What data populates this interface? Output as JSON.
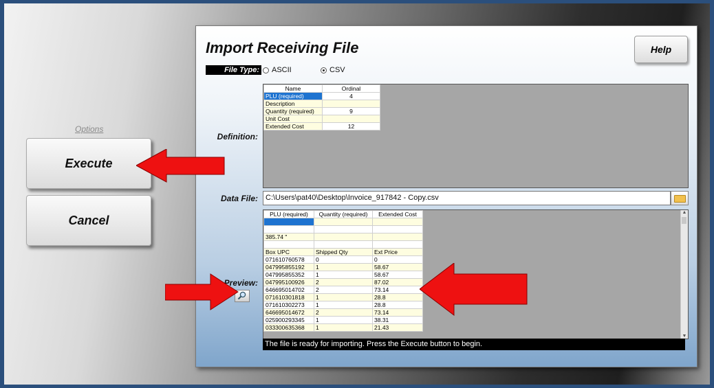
{
  "left": {
    "options_label": "Options",
    "execute_label": "Execute",
    "cancel_label": "Cancel"
  },
  "panel": {
    "title": "Import Receiving File",
    "help_label": "Help",
    "file_type_label": "File Type:",
    "file_types": [
      {
        "label": "ASCII",
        "selected": false
      },
      {
        "label": "CSV",
        "selected": true
      }
    ],
    "definition_label": "Definition:",
    "definition_table": {
      "headers": [
        "Name",
        "Ordinal"
      ],
      "rows": [
        {
          "name": "PLU (required)",
          "ordinal": "4"
        },
        {
          "name": "Description",
          "ordinal": ""
        },
        {
          "name": "Quantity (required)",
          "ordinal": "9"
        },
        {
          "name": "Unit Cost",
          "ordinal": ""
        },
        {
          "name": "Extended Cost",
          "ordinal": "12"
        }
      ]
    },
    "data_file_label": "Data File:",
    "data_file_value": "C:\\Users\\pat40\\Desktop\\Invoice_917842 - Copy.csv",
    "preview_label": "Preview:",
    "preview_table": {
      "headers": [
        "PLU (required)",
        "Quantity (required)",
        "Extended Cost"
      ],
      "rows": [
        [
          "",
          "",
          ""
        ],
        [
          "",
          "",
          ""
        ],
        [
          "385.74 \"",
          "",
          ""
        ],
        [
          "",
          "",
          ""
        ],
        [
          "Box UPC",
          "Shipped Qty",
          "Ext Price"
        ],
        [
          "071610760578",
          "0",
          "0"
        ],
        [
          "047995855192",
          "1",
          "58.67"
        ],
        [
          "047995855352",
          "1",
          "58.67"
        ],
        [
          "047995100926",
          "2",
          "87.02"
        ],
        [
          "646695014702",
          "2",
          "73.14"
        ],
        [
          "071610301818",
          "1",
          "28.8"
        ],
        [
          "071610302273",
          "1",
          "28.8"
        ],
        [
          "646695014672",
          "2",
          "73.14"
        ],
        [
          "025900293345",
          "1",
          "38.31"
        ],
        [
          "033300635368",
          "1",
          "21.43"
        ]
      ]
    },
    "status_text": "The file is ready for importing. Press the Execute button to begin."
  },
  "colors": {
    "arrow": "#ee1111",
    "selection": "#1e73d0",
    "row_highlight": "#fefde0"
  }
}
